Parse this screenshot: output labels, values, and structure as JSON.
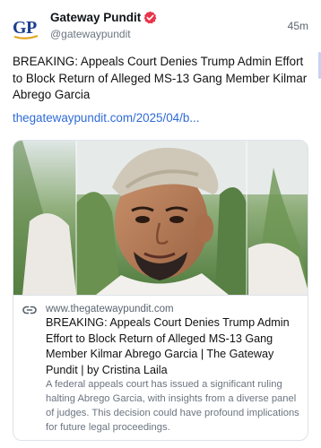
{
  "author": {
    "avatar_text": "GP",
    "name": "Gateway Pundit",
    "handle": "@gatewaypundit",
    "verified_icon": "verified-badge-icon",
    "time": "45m"
  },
  "post": {
    "text": "BREAKING: Appeals Court Denies Trump Admin Effort to Block Return of Alleged MS-13 Gang Member Kilmar Abrego Garcia",
    "link": "thegatewaypundit.com/2025/04/b..."
  },
  "card": {
    "image_icon": "man-photo",
    "link_icon": "link-icon",
    "domain": "www.thegatewaypundit.com",
    "title": "BREAKING: Appeals Court Denies Trump Admin Effort to Block Return of Alleged MS-13 Gang Member Kilmar Abrego Garcia | The Gateway Pundit | by Cristina Laila",
    "description": "A federal appeals court has issued a significant ruling halting Abrego Garcia, with insights from a diverse panel of judges. This decision could have profound implications for future legal proceedings."
  },
  "colors": {
    "brand_blue": "#1b3f8f",
    "brand_gold": "#e3a41b",
    "verified_red": "#e8344a",
    "link_blue": "#2f6bd8"
  }
}
